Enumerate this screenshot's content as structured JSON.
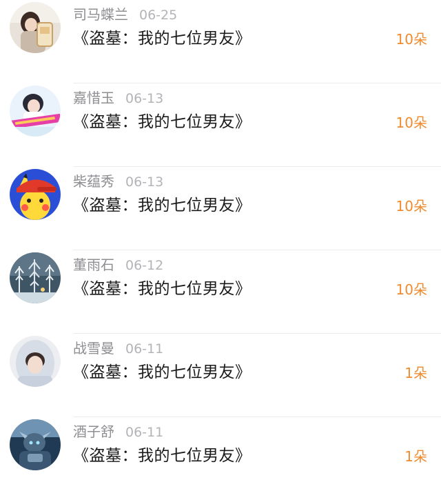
{
  "accent_color": "#f08a2c",
  "records": [
    {
      "name": "司马蝶兰",
      "date": "06-25",
      "title": "《盗墓：我的七位男友》",
      "amount": "10朵",
      "avatar_icon": "girl-with-cup-avatar"
    },
    {
      "name": "嘉惜玉",
      "date": "06-13",
      "title": "《盗墓：我的七位男友》",
      "amount": "10朵",
      "avatar_icon": "girl-pink-banner-avatar"
    },
    {
      "name": "柴蕴秀",
      "date": "06-13",
      "title": "《盗墓：我的七位男友》",
      "amount": "10朵",
      "avatar_icon": "pikachu-red-cap-avatar"
    },
    {
      "name": "董雨石",
      "date": "06-12",
      "title": "《盗墓：我的七位男友》",
      "amount": "10朵",
      "avatar_icon": "snowy-forest-avatar"
    },
    {
      "name": "战雪曼",
      "date": "06-11",
      "title": "《盗墓：我的七位男友》",
      "amount": "1朵",
      "avatar_icon": "girl-hood-avatar"
    },
    {
      "name": "酒子舒",
      "date": "06-11",
      "title": "《盗墓：我的七位男友》",
      "amount": "1朵",
      "avatar_icon": "armored-warrior-avatar"
    }
  ]
}
